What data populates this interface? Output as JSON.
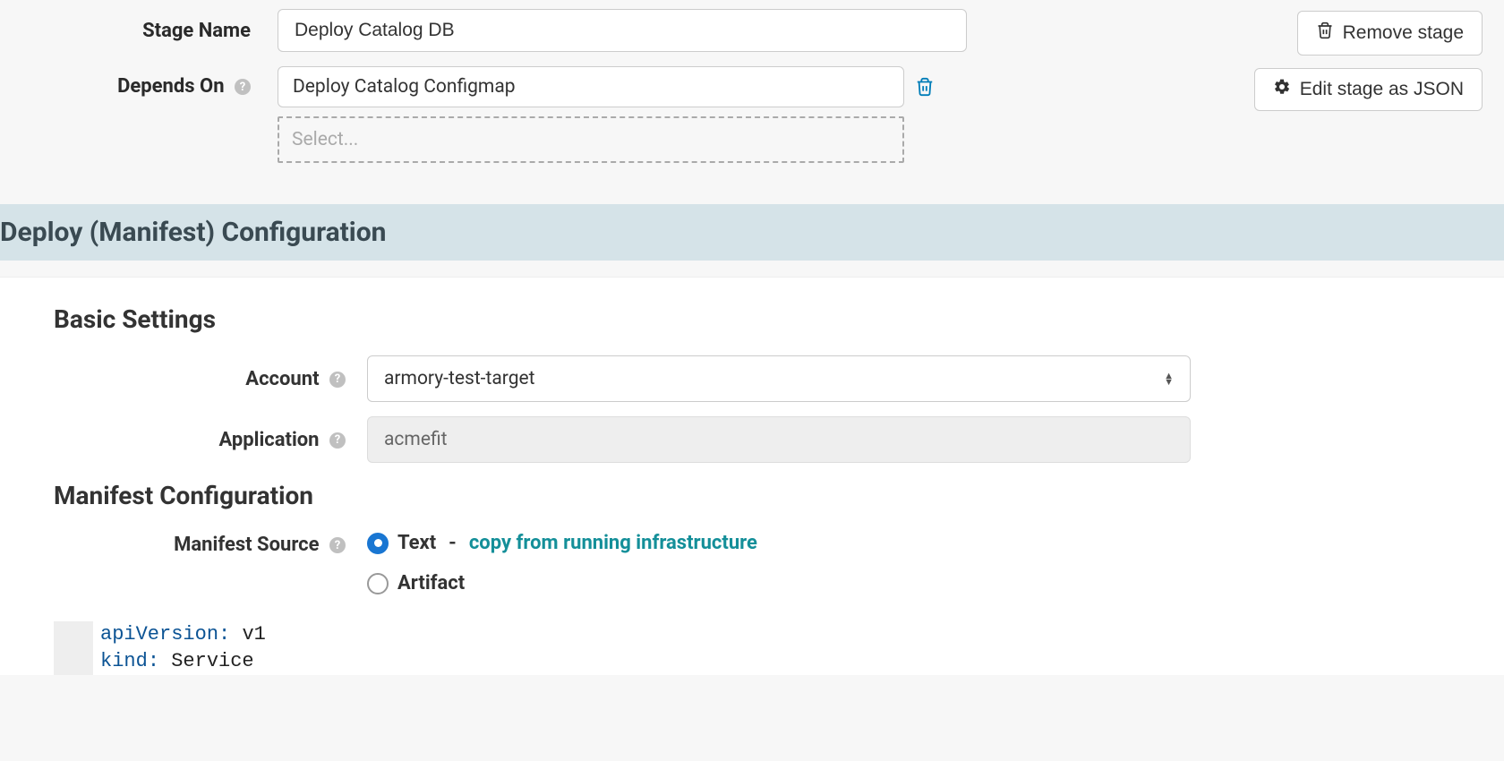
{
  "stage": {
    "name_label": "Stage Name",
    "name_value": "Deploy Catalog DB",
    "depends_label": "Depends On",
    "depends_value": "Deploy Catalog Configmap",
    "select_placeholder": "Select..."
  },
  "actions": {
    "remove": "Remove stage",
    "edit_json": "Edit stage as JSON"
  },
  "section_title": "Deploy (Manifest) Configuration",
  "basic": {
    "title": "Basic Settings",
    "account_label": "Account",
    "account_value": "armory-test-target",
    "application_label": "Application",
    "application_value": "acmefit"
  },
  "manifest": {
    "title": "Manifest Configuration",
    "source_label": "Manifest Source",
    "text_option": "Text",
    "copy_link": "copy from running infrastructure",
    "artifact_option": "Artifact"
  },
  "code": {
    "line1_key": "apiVersion",
    "line1_value": "v1",
    "line2_key": "kind",
    "line2_value": "Service"
  },
  "help_glyph": "?"
}
